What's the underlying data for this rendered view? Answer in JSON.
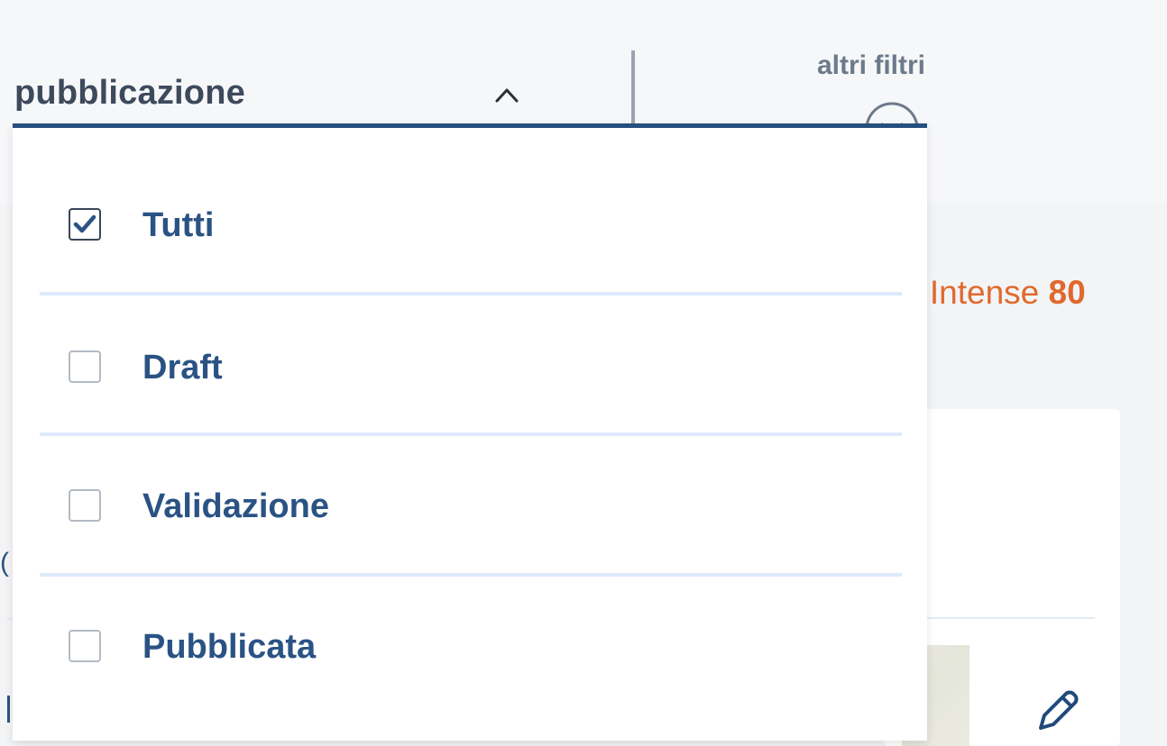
{
  "filter": {
    "label": "pubblicazione",
    "other_filters": "altri filtri"
  },
  "background": {
    "intense_prefix": "e Intense ",
    "intense_count": "80",
    "left_partial": "("
  },
  "dropdown": {
    "options": [
      {
        "label": "Tutti",
        "checked": true
      },
      {
        "label": "Draft",
        "checked": false
      },
      {
        "label": "Validazione",
        "checked": false
      },
      {
        "label": "Pubblicata",
        "checked": false
      }
    ]
  },
  "colors": {
    "accent": "#254f7e",
    "label_text": "#2a5384",
    "orange": "#e0692e"
  },
  "icons": [
    "chevron-up-icon",
    "chevron-down-circle-icon",
    "checkmark-icon",
    "pencil-icon"
  ]
}
